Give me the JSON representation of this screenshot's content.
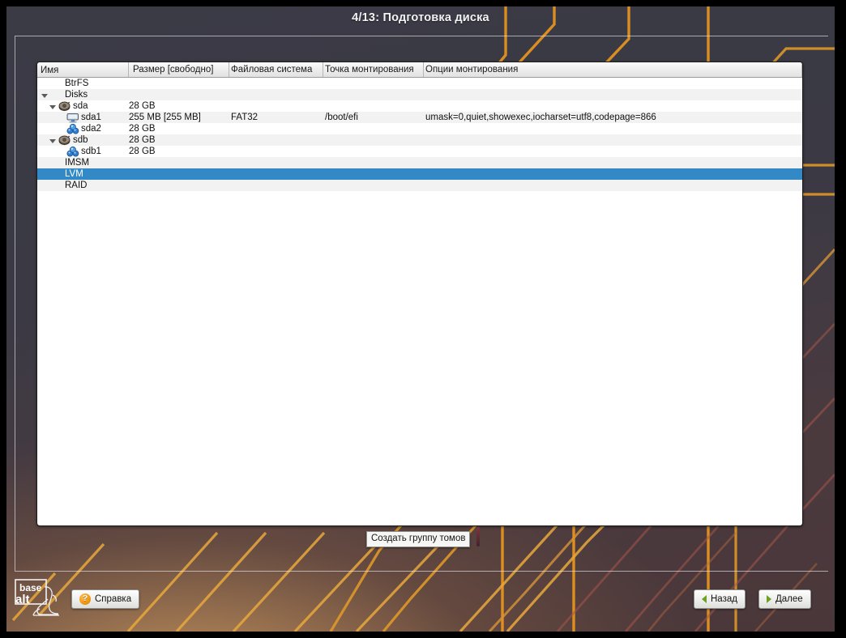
{
  "window": {
    "title": "4/13: Подготовка диска"
  },
  "table": {
    "columns": [
      {
        "label": "Имя",
        "key": "name"
      },
      {
        "label": "Размер [свободно]",
        "key": "size"
      },
      {
        "label": "Файловая система",
        "key": "fs"
      },
      {
        "label": "Точка монтирования",
        "key": "mount"
      },
      {
        "label": "Опции монтирования",
        "key": "options"
      }
    ],
    "rows": [
      {
        "name": "BtrFS",
        "size": "",
        "fs": "",
        "mount": "",
        "options": "",
        "depth": 0,
        "twisty": "none",
        "icon": "none",
        "selected": false
      },
      {
        "name": "Disks",
        "size": "",
        "fs": "",
        "mount": "",
        "options": "",
        "depth": 0,
        "twisty": "open",
        "icon": "none",
        "selected": false
      },
      {
        "name": "sda",
        "size": "28 GB",
        "fs": "",
        "mount": "",
        "options": "",
        "depth": 1,
        "twisty": "open",
        "icon": "hard-disk-icon",
        "selected": false
      },
      {
        "name": "sda1",
        "size": "255 MB [255 MB]",
        "fs": "FAT32",
        "mount": "/boot/efi",
        "options": "umask=0,quiet,showexec,iocharset=utf8,codepage=866",
        "depth": 2,
        "twisty": "none",
        "icon": "fat-partition-icon",
        "selected": false
      },
      {
        "name": "sda2",
        "size": "28 GB",
        "fs": "",
        "mount": "",
        "options": "",
        "depth": 2,
        "twisty": "none",
        "icon": "lvm-partition-icon",
        "selected": false
      },
      {
        "name": "sdb",
        "size": "28 GB",
        "fs": "",
        "mount": "",
        "options": "",
        "depth": 1,
        "twisty": "open",
        "icon": "hard-disk-icon",
        "selected": false
      },
      {
        "name": "sdb1",
        "size": "28 GB",
        "fs": "",
        "mount": "",
        "options": "",
        "depth": 2,
        "twisty": "none",
        "icon": "lvm-partition-icon",
        "selected": false
      },
      {
        "name": "IMSM",
        "size": "",
        "fs": "",
        "mount": "",
        "options": "",
        "depth": 0,
        "twisty": "none",
        "icon": "none",
        "selected": false
      },
      {
        "name": "LVM",
        "size": "",
        "fs": "",
        "mount": "",
        "options": "",
        "depth": 0,
        "twisty": "none",
        "icon": "none",
        "selected": true
      },
      {
        "name": "RAID",
        "size": "",
        "fs": "",
        "mount": "",
        "options": "",
        "depth": 0,
        "twisty": "none",
        "icon": "none",
        "selected": false
      }
    ]
  },
  "tooltip": {
    "text": "Создать группу томов"
  },
  "logo": {
    "line1": "base",
    "line2": "alt"
  },
  "buttons": {
    "help": "Справка",
    "back": "Назад",
    "next": "Далее"
  },
  "colors": {
    "selection": "#3289c6",
    "accent_orange": "#e6941f",
    "arrow_green": "#6ea023",
    "help_icon": "#f09a16",
    "panel_bg": "#ffffff",
    "row_alt_bg": "#f2f2f2",
    "title_text": "#f3f3f5"
  }
}
